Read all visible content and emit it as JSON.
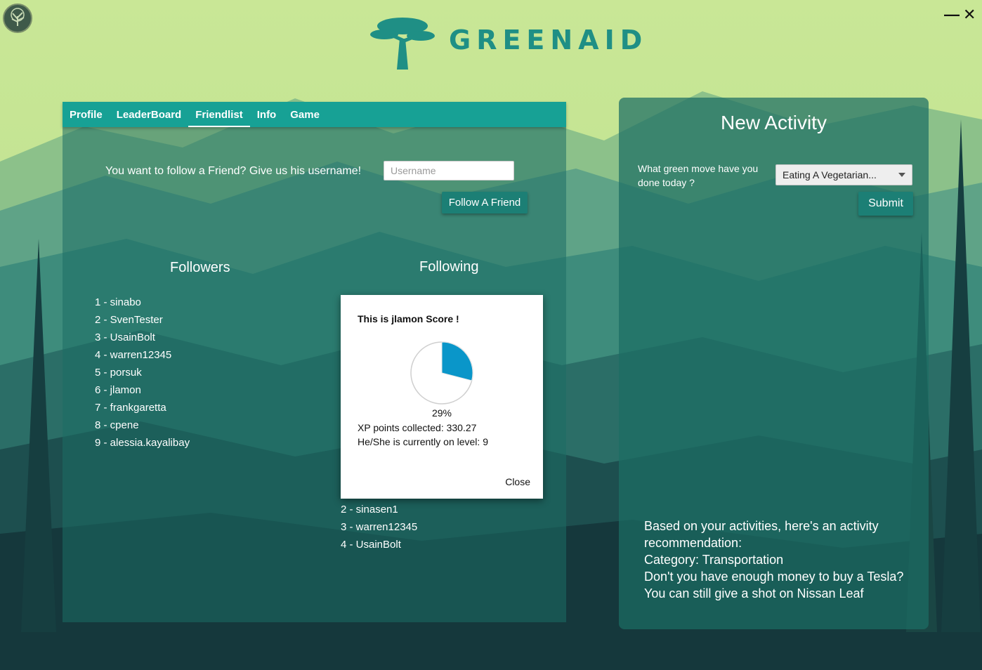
{
  "app": {
    "brand": "GREENAID",
    "minimize_label": "—",
    "close_label": "✕",
    "app_icon": "tree-icon"
  },
  "tabs": [
    {
      "label": "Profile"
    },
    {
      "label": "LeaderBoard"
    },
    {
      "label": "Friendlist",
      "active": true
    },
    {
      "label": "Info"
    },
    {
      "label": "Game"
    }
  ],
  "friendlist": {
    "prompt": "You want to follow a Friend? Give us his username!",
    "username_placeholder": "Username",
    "follow_button": "Follow A Friend",
    "followers_heading": "Followers",
    "following_heading": "Following",
    "followers": [
      "1 - sinabo",
      "2 - SvenTester",
      "3 - UsainBolt",
      "4 - warren12345",
      "5 - porsuk",
      "6 - jlamon",
      "7 - frankgaretta",
      "8 - cpene",
      "9 - alessia.kayalibay"
    ],
    "following": [
      "2 - sinasen1",
      "3 - warren12345",
      "4 - UsainBolt"
    ]
  },
  "score_popup": {
    "title": "This is jlamon Score !",
    "percent_label": "29%",
    "progress": 0.29,
    "xp_text": "XP points collected: 330.27",
    "level_text": "He/She is currently on level: 9",
    "close_label": "Close",
    "fill_color": "#0a96c9"
  },
  "new_activity": {
    "title": "New Activity",
    "question": "What green move have you done today ?",
    "selected_activity": "Eating A Vegetarian...",
    "submit_label": "Submit",
    "recommendation_lines": [
      "Based on your activities, here's an activity",
      "recommendation:",
      "Category: Transportation",
      "Don't you have enough money to buy a Tesla?",
      "You can still give a shot on Nissan Leaf"
    ]
  },
  "colors": {
    "accent": "#17a195",
    "button": "#1c7f75",
    "logo": "#1f8f85"
  }
}
